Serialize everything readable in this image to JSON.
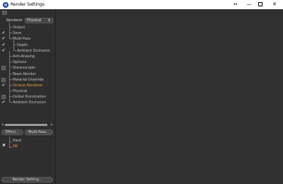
{
  "window": {
    "title": "Render Settings",
    "resize_glyph": "↔",
    "minimize_glyph": "—",
    "close_glyph": "✕"
  },
  "renderer": {
    "label": "Renderer",
    "selected": "Physical",
    "arrow": "▼"
  },
  "tree": {
    "items": [
      {
        "label": "Output",
        "checkbox": "",
        "indent": 0,
        "active": false
      },
      {
        "label": "Save",
        "checkbox": "✔",
        "indent": 0,
        "active": false
      },
      {
        "label": "Multi-Pass",
        "checkbox": "✔",
        "indent": 0,
        "active": false
      },
      {
        "label": "Depth",
        "checkbox": "✔",
        "indent": 1,
        "active": false
      },
      {
        "label": "Ambient Occlusion",
        "checkbox": "✔",
        "indent": 1,
        "active": false
      },
      {
        "label": "Anti-Aliasing",
        "checkbox": "",
        "indent": 0,
        "active": false
      },
      {
        "label": "Options",
        "checkbox": "",
        "indent": 0,
        "active": false
      },
      {
        "label": "Stereoscopic",
        "checkbox": "box",
        "indent": 0,
        "active": false
      },
      {
        "label": "Team Render",
        "checkbox": "",
        "indent": 0,
        "active": false
      },
      {
        "label": "Material Override",
        "checkbox": "box",
        "indent": 0,
        "active": false
      },
      {
        "label": "Octane Renderer",
        "checkbox": "✔",
        "indent": 0,
        "active": true
      },
      {
        "label": "Physical",
        "checkbox": "",
        "indent": 0,
        "active": false
      },
      {
        "label": "Global Illumination",
        "checkbox": "box",
        "indent": 0,
        "active": false
      },
      {
        "label": "Ambient Occlusion",
        "checkbox": "✔",
        "indent": 0,
        "active": false
      }
    ]
  },
  "scroll": {
    "left": "◀",
    "right": "▶"
  },
  "buttons": {
    "effect": "Effect...",
    "multipass": "Multi-Pass...",
    "render_setting": "Render Setting..."
  },
  "presets": {
    "icon": "✖",
    "items": [
      {
        "label": "Hard",
        "active": false
      },
      {
        "label": "OK",
        "active": true
      }
    ]
  },
  "colors": {
    "accent": "#f0a12a",
    "panel": "#2e2e2e",
    "main": "#303030"
  }
}
